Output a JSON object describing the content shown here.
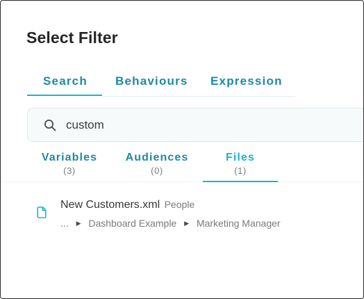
{
  "dialog": {
    "title": "Select Filter"
  },
  "tabs": {
    "items": [
      {
        "label": "Search",
        "active": true
      },
      {
        "label": "Behaviours",
        "active": false
      },
      {
        "label": "Expression",
        "active": false
      }
    ]
  },
  "search": {
    "value": "custom",
    "icon": "search-icon"
  },
  "result_tabs": {
    "items": [
      {
        "label": "Variables",
        "count": "(3)",
        "active": false
      },
      {
        "label": "Audiences",
        "count": "(0)",
        "active": false
      },
      {
        "label": "Files",
        "count": "(1)",
        "active": true
      }
    ]
  },
  "results": [
    {
      "icon": "file-icon",
      "name": "New Customers.xml",
      "type": "People",
      "path": [
        "...",
        "Dashboard Example",
        "Marketing Manager"
      ]
    }
  ],
  "colors": {
    "accent": "#18b4d6",
    "tab_text": "#1d8aa2",
    "title": "#262626",
    "muted": "#7a7a7a"
  }
}
